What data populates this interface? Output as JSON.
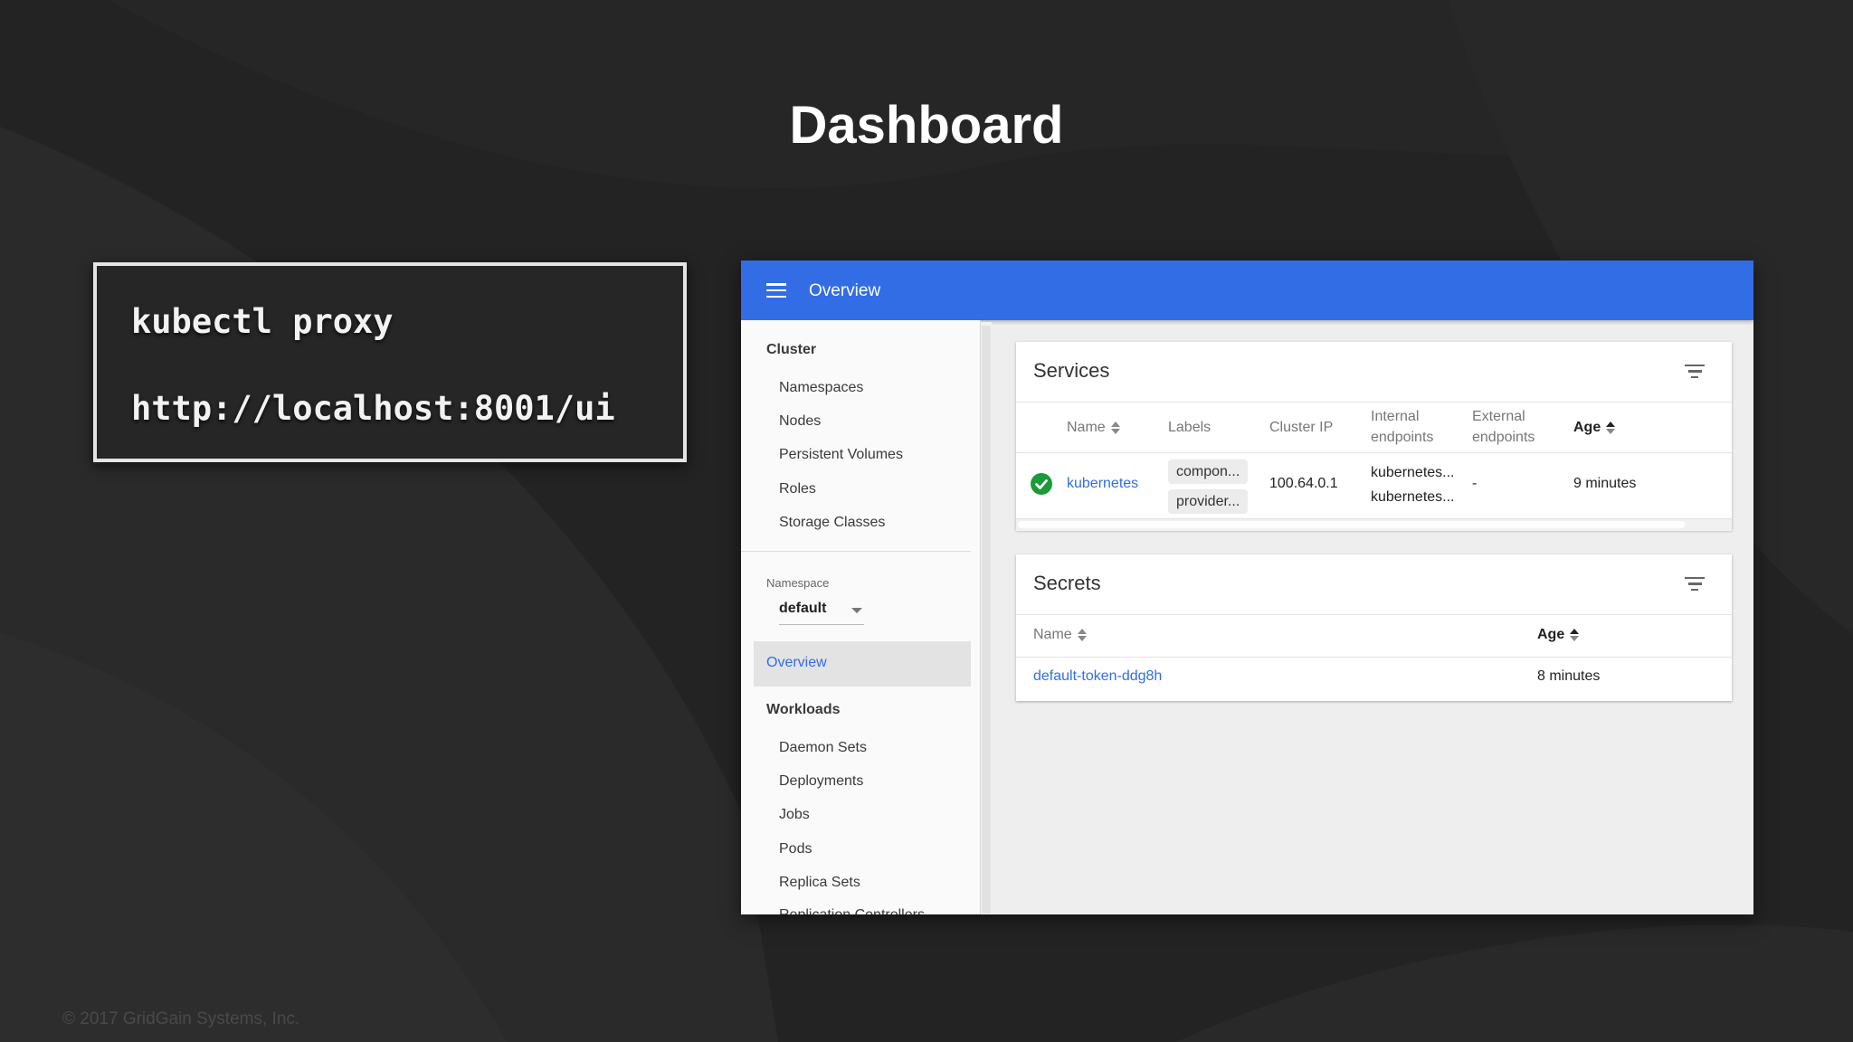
{
  "slide": {
    "title": "Dashboard",
    "code_lines": [
      "kubectl proxy",
      "http://localhost:8001/ui"
    ],
    "copyright": "© 2017 GridGain Systems, Inc."
  },
  "colors": {
    "background": "#232323",
    "topbar": "#326de6",
    "link": "#326de6",
    "ok_status": "#1a9a3a"
  },
  "dashboard": {
    "topbar": {
      "title": "Overview",
      "menu_icon": "menu-icon"
    },
    "sidebar": {
      "cluster_heading": "Cluster",
      "cluster_items": [
        "Namespaces",
        "Nodes",
        "Persistent Volumes",
        "Roles",
        "Storage Classes"
      ],
      "namespace_label": "Namespace",
      "namespace_value": "default",
      "active_item": "Overview",
      "workloads_heading": "Workloads",
      "workload_items": [
        "Daemon Sets",
        "Deployments",
        "Jobs",
        "Pods",
        "Replica Sets",
        "Replication Controllers"
      ]
    },
    "services": {
      "title": "Services",
      "filter_icon": "filter-icon",
      "columns": {
        "name": "Name",
        "labels": "Labels",
        "cluster_ip": "Cluster IP",
        "internal_1": "Internal",
        "internal_2": "endpoints",
        "external_1": "External",
        "external_2": "endpoints",
        "age": "Age"
      },
      "rows": [
        {
          "status_icon": "check-circle-icon",
          "name": "kubernetes",
          "labels": [
            "compon...",
            "provider..."
          ],
          "cluster_ip": "100.64.0.1",
          "internal_endpoints": [
            "kubernetes...",
            "kubernetes..."
          ],
          "external_endpoints": "-",
          "age": "9 minutes"
        }
      ]
    },
    "secrets": {
      "title": "Secrets",
      "filter_icon": "filter-icon",
      "columns": {
        "name": "Name",
        "age": "Age"
      },
      "rows": [
        {
          "name": "default-token-ddg8h",
          "age": "8 minutes"
        }
      ]
    }
  }
}
